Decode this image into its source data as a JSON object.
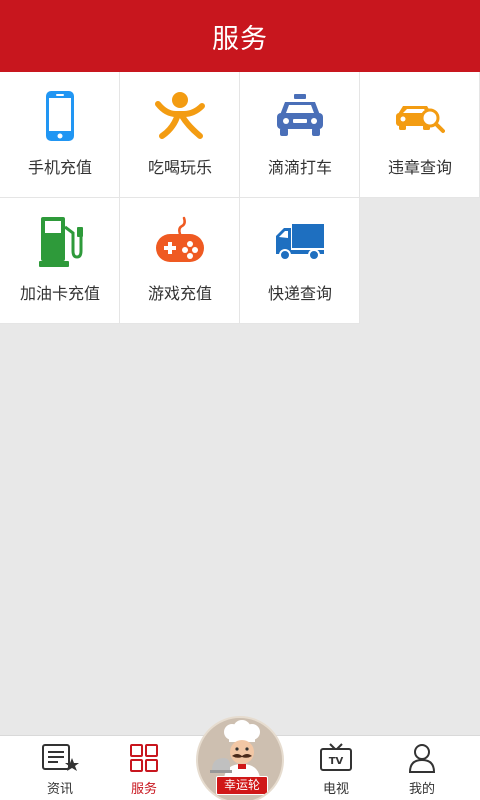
{
  "header": {
    "title": "服务"
  },
  "services": [
    {
      "label": "手机充值",
      "icon": "phone-icon"
    },
    {
      "label": "吃喝玩乐",
      "icon": "person-icon"
    },
    {
      "label": "滴滴打车",
      "icon": "taxi-icon"
    },
    {
      "label": "违章查询",
      "icon": "car-search-icon"
    },
    {
      "label": "加油卡充值",
      "icon": "fuel-pump-icon"
    },
    {
      "label": "游戏充值",
      "icon": "gamepad-icon"
    },
    {
      "label": "快递查询",
      "icon": "truck-icon"
    }
  ],
  "bottom_nav": {
    "news": "资讯",
    "services": "服务",
    "lucky_wheel": "幸运轮",
    "tv": "电视",
    "mine": "我的",
    "tv_icon_text": "TV"
  },
  "colors": {
    "brand_red": "#c8161e",
    "phone_blue": "#2196f3",
    "orange": "#f39c12",
    "taxi_blue": "#4a6fb8",
    "fuel_green": "#2e9a3a",
    "game_orange": "#ef5a22",
    "truck_blue": "#1e6fc0"
  }
}
